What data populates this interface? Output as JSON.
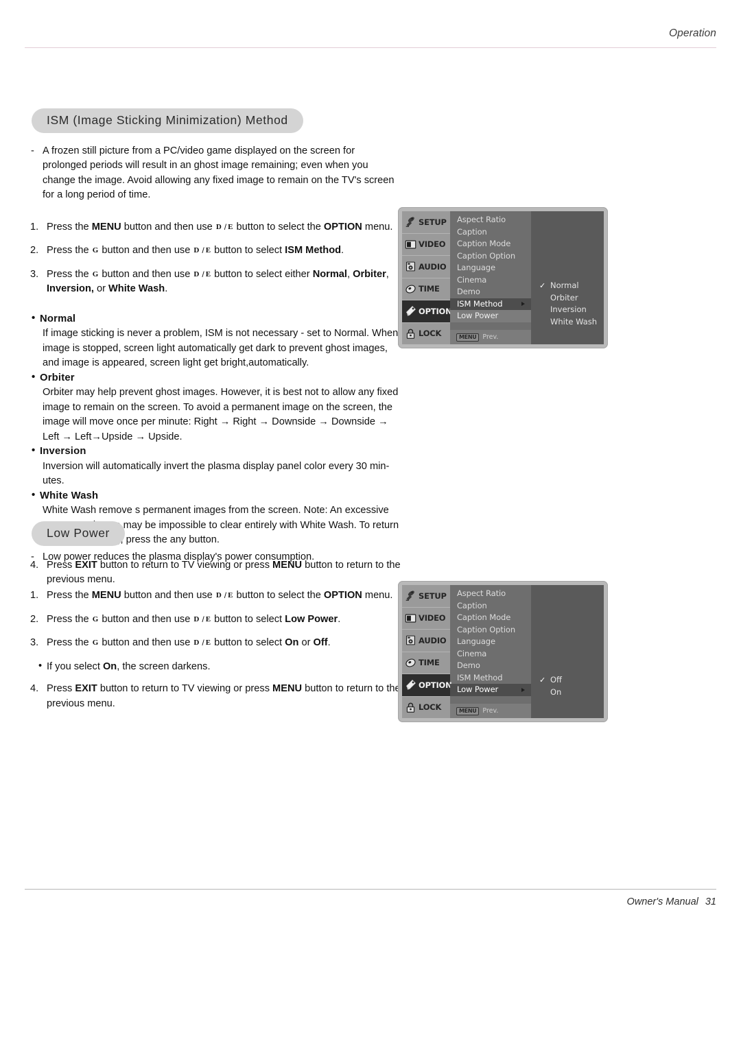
{
  "header": {
    "label": "Operation"
  },
  "footer": {
    "manual_label": "Owner's Manual",
    "page_number": "31"
  },
  "symbols": {
    "up": "D",
    "down": "E",
    "right": "G",
    "slash": "/",
    "bullet": "•",
    "dash": "-",
    "check": "✓",
    "arrow": "→"
  },
  "sections": [
    {
      "id": "ism",
      "title": "ISM (Image Sticking Minimization) Method",
      "intro": "A frozen still picture from a PC/video game displayed on the screen for prolonged periods will result in an ghost image remaining; even when you change the image. Avoid allowing any fixed image to remain on the TV's screen for a long period of time.",
      "steps": [
        {
          "num": "1.",
          "parts": [
            {
              "t": "Press the ",
              "b": false
            },
            {
              "t": "MENU",
              "b": true
            },
            {
              "t": " button and then use ",
              "b": false
            },
            {
              "t": "SYM_UPDOWN",
              "b": false
            },
            {
              "t": " button to select the ",
              "b": false
            },
            {
              "t": "OPTION",
              "b": true
            },
            {
              "t": " menu.",
              "b": false
            }
          ]
        },
        {
          "num": "2.",
          "parts": [
            {
              "t": "Press the ",
              "b": false
            },
            {
              "t": "SYM_RIGHT",
              "b": false
            },
            {
              "t": " button and then use ",
              "b": false
            },
            {
              "t": "SYM_UPDOWN",
              "b": false
            },
            {
              "t": " button to select ",
              "b": false
            },
            {
              "t": "ISM Method",
              "b": true
            },
            {
              "t": ".",
              "b": false
            }
          ]
        },
        {
          "num": "3.",
          "parts": [
            {
              "t": "Press the ",
              "b": false
            },
            {
              "t": "SYM_RIGHT",
              "b": false
            },
            {
              "t": " button and then use ",
              "b": false
            },
            {
              "t": "SYM_UPDOWN",
              "b": false
            },
            {
              "t": " button to select either ",
              "b": false
            },
            {
              "t": "Normal",
              "b": true
            },
            {
              "t": ", ",
              "b": false
            },
            {
              "t": "Orbiter",
              "b": true
            },
            {
              "t": ", ",
              "b": false
            },
            {
              "t": "Inversion,",
              "b": true
            },
            {
              "t": " or ",
              "b": false
            },
            {
              "t": "White Wash",
              "b": true
            },
            {
              "t": ".",
              "b": false
            }
          ]
        }
      ],
      "options": [
        {
          "name": "Normal",
          "desc": "If image sticking is never a problem, ISM is not necessary - set to Normal. When image is stopped, screen light automatically get dark to prevent ghost images, and image is appeared, screen light get bright,automatically."
        },
        {
          "name": "Orbiter",
          "desc": "Orbiter may help prevent ghost images. However, it is best not to allow any fixed image to remain on the screen. To avoid a permanent image on the screen, the image will move once per minute: Right → Right → Downside → Downside → Left → Left→Upside  → Upside."
        },
        {
          "name": "Inversion",
          "desc": "Inversion will automatically invert the plasma display panel color every 30 min-utes."
        },
        {
          "name": "White Wash",
          "desc": "White Wash remove s permanent images from the screen. Note: An excessive permanent image may be impossible to clear entirely with White Wash. To return to normal viewing, press the any button."
        }
      ],
      "final_step": {
        "num": "4.",
        "parts": [
          {
            "t": "Press ",
            "b": false
          },
          {
            "t": "EXIT",
            "b": true
          },
          {
            "t": " button to return to TV viewing or press ",
            "b": false
          },
          {
            "t": "MENU",
            "b": true
          },
          {
            "t": " button to return to the previous menu.",
            "b": false
          }
        ]
      }
    },
    {
      "id": "low",
      "title": "Low Power",
      "intro": "Low power reduces the plasma display's power consumption.",
      "steps": [
        {
          "num": "1.",
          "parts": [
            {
              "t": "Press the ",
              "b": false
            },
            {
              "t": "MENU",
              "b": true
            },
            {
              "t": " button and then use ",
              "b": false
            },
            {
              "t": "SYM_UPDOWN",
              "b": false
            },
            {
              "t": " button to select the ",
              "b": false
            },
            {
              "t": "OPTION",
              "b": true
            },
            {
              "t": " menu.",
              "b": false
            }
          ]
        },
        {
          "num": "2.",
          "parts": [
            {
              "t": "Press the ",
              "b": false
            },
            {
              "t": "SYM_RIGHT",
              "b": false
            },
            {
              "t": " button and then use ",
              "b": false
            },
            {
              "t": "SYM_UPDOWN",
              "b": false
            },
            {
              "t": " button to select ",
              "b": false
            },
            {
              "t": "Low Power",
              "b": true
            },
            {
              "t": ".",
              "b": false
            }
          ]
        },
        {
          "num": "3.",
          "parts": [
            {
              "t": "Press the ",
              "b": false
            },
            {
              "t": "SYM_RIGHT",
              "b": false
            },
            {
              "t": " button and then use ",
              "b": false
            },
            {
              "t": "SYM_UPDOWN",
              "b": false
            },
            {
              "t": " button to select ",
              "b": false
            },
            {
              "t": "On",
              "b": true
            },
            {
              "t": " or ",
              "b": false
            },
            {
              "t": "Off",
              "b": true
            },
            {
              "t": ".",
              "b": false
            }
          ]
        }
      ],
      "sub_bullet": {
        "parts": [
          {
            "t": "If you select ",
            "b": false
          },
          {
            "t": "On",
            "b": true
          },
          {
            "t": ", the screen darkens.",
            "b": false
          }
        ]
      },
      "final_step": {
        "num": "4.",
        "parts": [
          {
            "t": "Press ",
            "b": false
          },
          {
            "t": "EXIT",
            "b": true
          },
          {
            "t": " button to return to TV viewing or press ",
            "b": false
          },
          {
            "t": "MENU",
            "b": true
          },
          {
            "t": " button to return to the previous menu.",
            "b": false
          }
        ]
      }
    }
  ],
  "osd": {
    "rail": [
      {
        "label": "SETUP",
        "icon": "satellite-dish-icon",
        "active": false
      },
      {
        "label": "VIDEO",
        "icon": "monitor-icon",
        "active": false
      },
      {
        "label": "AUDIO",
        "icon": "speaker-icon",
        "active": false
      },
      {
        "label": "TIME",
        "icon": "clock-icon",
        "active": false
      },
      {
        "label": "OPTION",
        "icon": "tag-icon",
        "active": true
      },
      {
        "label": "LOCK",
        "icon": "padlock-icon",
        "active": false
      }
    ],
    "menu_items": [
      "Aspect Ratio",
      "Caption",
      "Caption Mode",
      "Caption Option",
      "Language",
      "Cinema",
      "Demo",
      "ISM Method",
      "Low Power"
    ],
    "footer_badge": "MENU",
    "footer_label": "Prev.",
    "ism_panel": {
      "selected_item": "ISM Method",
      "banded_item": "Low Power",
      "options": [
        {
          "label": "Normal",
          "checked": true
        },
        {
          "label": "Orbiter",
          "checked": false
        },
        {
          "label": "Inversion",
          "checked": false
        },
        {
          "label": "White Wash",
          "checked": false
        }
      ]
    },
    "low_panel": {
      "selected_item": "Low Power",
      "banded_item": "",
      "options": [
        {
          "label": "Off",
          "checked": true
        },
        {
          "label": "On",
          "checked": false
        }
      ]
    }
  },
  "colors": {
    "pill_bg": "#d4d4d4",
    "header_rule": "#e3cdd6",
    "osd_frame": "#b9b9b9",
    "osd_rail": "#9a9a9a",
    "osd_mid": "#6e6e6e",
    "osd_right": "#5a5a5a",
    "osd_active": "#2e2e2e"
  }
}
